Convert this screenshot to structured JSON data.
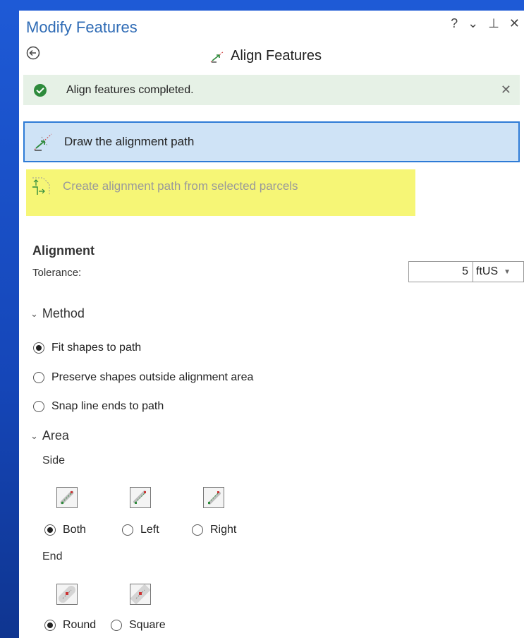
{
  "panel": {
    "title": "Modify Features",
    "controls": {
      "help": "?",
      "menu": "⌄",
      "pin": "⊥",
      "close": "✕"
    }
  },
  "tool": {
    "title": "Align Features",
    "back_icon": "back-arrow-icon"
  },
  "notification": {
    "text": "Align features completed.",
    "close": "✕"
  },
  "actions": {
    "draw_path": "Draw the alignment path",
    "create_path": "Create alignment path from selected parcels"
  },
  "alignment": {
    "section": "Alignment",
    "tolerance_label": "Tolerance:",
    "tolerance_value": "5",
    "tolerance_unit": "ftUS"
  },
  "method": {
    "header": "Method",
    "options": [
      {
        "label": "Fit shapes to path",
        "selected": true
      },
      {
        "label": "Preserve shapes outside alignment area",
        "selected": false
      },
      {
        "label": "Snap line ends to path",
        "selected": false
      }
    ]
  },
  "area": {
    "header": "Area",
    "side_label": "Side",
    "side_options": [
      {
        "label": "Both",
        "selected": true
      },
      {
        "label": "Left",
        "selected": false
      },
      {
        "label": "Right",
        "selected": false
      }
    ],
    "end_label": "End",
    "end_options": [
      {
        "label": "Round",
        "selected": true
      },
      {
        "label": "Square",
        "selected": false
      }
    ]
  },
  "colors": {
    "accent": "#2e6bb5",
    "highlight": "#f4f55e",
    "selected_bg": "#cfe3f6",
    "success_bg": "#e6f1e6"
  }
}
